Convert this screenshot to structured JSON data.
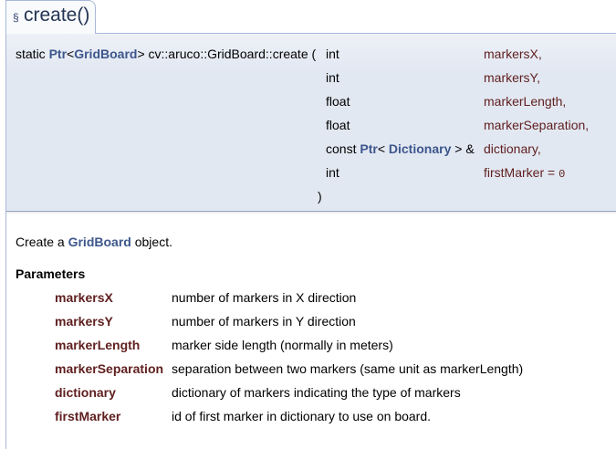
{
  "tab": {
    "section_symbol": "§",
    "title": "create()"
  },
  "signature": {
    "prefix_static": "static",
    "return_type_ptr": "Ptr",
    "return_type_open": "<",
    "return_type_class": "GridBoard",
    "return_type_close": ">",
    "qualified_name": "cv::aruco::GridBoard::create",
    "open_paren": "(",
    "close_paren": ")",
    "params": [
      {
        "type": "int",
        "name": "markersX,"
      },
      {
        "type": "int",
        "name": "markersY,"
      },
      {
        "type": "float",
        "name": "markerLength,"
      },
      {
        "type": "float",
        "name": "markerSeparation,"
      },
      {
        "type_prefix": "const",
        "type_ptr": "Ptr",
        "type_open": "<",
        "type_class": "Dictionary",
        "type_close": "> &",
        "name": "dictionary,"
      },
      {
        "type": "int",
        "name": "firstMarker =",
        "default": "0"
      }
    ]
  },
  "description": {
    "before": "Create a",
    "link": "GridBoard",
    "after": "object."
  },
  "parameters": {
    "title": "Parameters",
    "rows": [
      {
        "name": "markersX",
        "desc": "number of markers in X direction"
      },
      {
        "name": "markersY",
        "desc": "number of markers in Y direction"
      },
      {
        "name": "markerLength",
        "desc": "marker side length (normally in meters)"
      },
      {
        "name": "markerSeparation",
        "desc": "separation between two markers (same unit as markerLength)"
      },
      {
        "name": "dictionary",
        "desc": "dictionary of markers indicating the type of markers"
      },
      {
        "name": "firstMarker",
        "desc": "id of first marker in dictionary to use on board."
      }
    ]
  }
}
